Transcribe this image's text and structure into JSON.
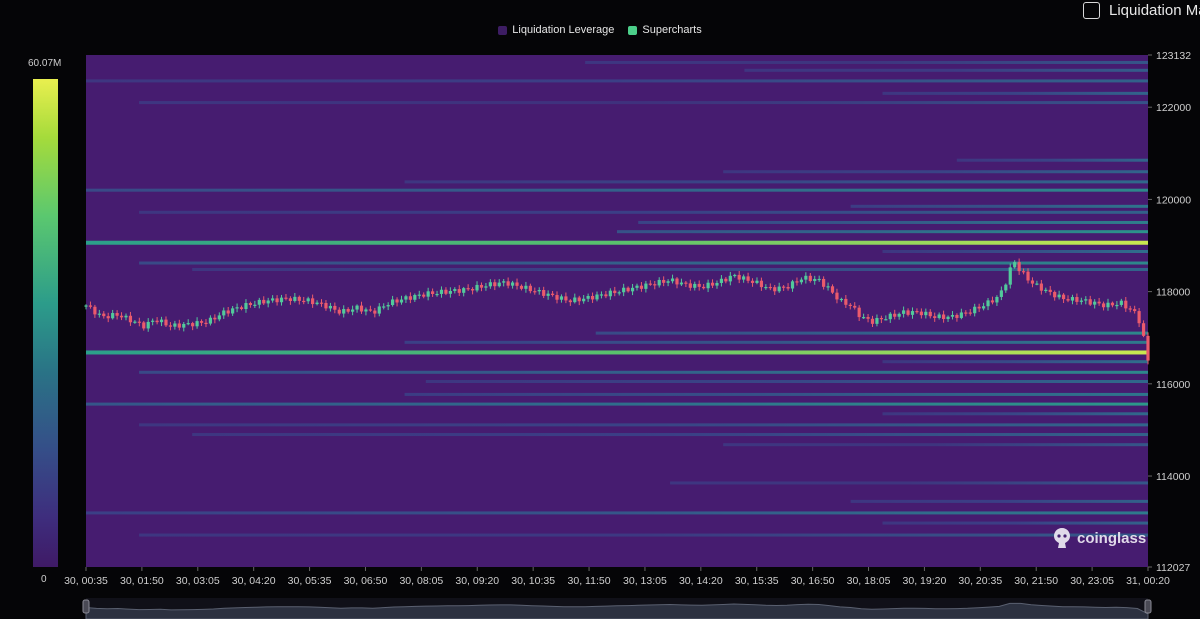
{
  "legend": [
    {
      "label": "Liquidation Leverage",
      "color": "#3d1d63"
    },
    {
      "label": "Supercharts",
      "color": "#4ccf8a"
    }
  ],
  "toggle_label": "Liquidation Ma",
  "color_scale": {
    "max_label": "60.07M",
    "min_label": "0"
  },
  "watermark": "coinglass",
  "chart_data": {
    "type": "heatmap",
    "y_axis": {
      "min": 112027,
      "max": 123132,
      "ticks": [
        "123132",
        "122000",
        "120000",
        "118000",
        "116000",
        "114000",
        "112027"
      ]
    },
    "x_axis": {
      "ticks": [
        "30, 00:35",
        "30, 01:50",
        "30, 03:05",
        "30, 04:20",
        "30, 05:35",
        "30, 06:50",
        "30, 08:05",
        "30, 09:20",
        "30, 10:35",
        "30, 11:50",
        "30, 13:05",
        "30, 14:20",
        "30, 15:35",
        "30, 16:50",
        "30, 18:05",
        "30, 19:20",
        "30, 20:35",
        "30, 21:50",
        "30, 23:05",
        "31, 00:20"
      ]
    },
    "background_color": "#461c70",
    "liquidation_bands": [
      {
        "price": 122970,
        "start": 0.47,
        "intensity": 0.32
      },
      {
        "price": 122800,
        "start": 0.62,
        "intensity": 0.35
      },
      {
        "price": 122570,
        "start": 0.0,
        "intensity": 0.38
      },
      {
        "price": 122300,
        "start": 0.75,
        "intensity": 0.4
      },
      {
        "price": 122100,
        "start": 0.05,
        "intensity": 0.3
      },
      {
        "price": 120850,
        "start": 0.82,
        "intensity": 0.4
      },
      {
        "price": 120600,
        "start": 0.6,
        "intensity": 0.4
      },
      {
        "price": 120380,
        "start": 0.3,
        "intensity": 0.42
      },
      {
        "price": 120200,
        "start": 0.0,
        "intensity": 0.55
      },
      {
        "price": 119850,
        "start": 0.72,
        "intensity": 0.48
      },
      {
        "price": 119720,
        "start": 0.05,
        "intensity": 0.38
      },
      {
        "price": 119500,
        "start": 0.52,
        "intensity": 0.52
      },
      {
        "price": 119300,
        "start": 0.5,
        "intensity": 0.6
      },
      {
        "price": 119060,
        "start": 0.0,
        "intensity": 0.95
      },
      {
        "price": 118870,
        "start": 0.75,
        "intensity": 0.45
      },
      {
        "price": 118620,
        "start": 0.05,
        "intensity": 0.55
      },
      {
        "price": 118480,
        "start": 0.1,
        "intensity": 0.4
      },
      {
        "price": 117100,
        "start": 0.48,
        "intensity": 0.55
      },
      {
        "price": 116900,
        "start": 0.3,
        "intensity": 0.5
      },
      {
        "price": 116680,
        "start": 0.0,
        "intensity": 0.95
      },
      {
        "price": 116480,
        "start": 0.75,
        "intensity": 0.45
      },
      {
        "price": 116250,
        "start": 0.05,
        "intensity": 0.55
      },
      {
        "price": 116050,
        "start": 0.32,
        "intensity": 0.42
      },
      {
        "price": 115770,
        "start": 0.3,
        "intensity": 0.48
      },
      {
        "price": 115560,
        "start": 0.0,
        "intensity": 0.62
      },
      {
        "price": 115350,
        "start": 0.75,
        "intensity": 0.42
      },
      {
        "price": 115110,
        "start": 0.05,
        "intensity": 0.4
      },
      {
        "price": 114900,
        "start": 0.1,
        "intensity": 0.38
      },
      {
        "price": 114680,
        "start": 0.6,
        "intensity": 0.32
      },
      {
        "price": 113850,
        "start": 0.55,
        "intensity": 0.32
      },
      {
        "price": 113450,
        "start": 0.72,
        "intensity": 0.38
      },
      {
        "price": 113200,
        "start": 0.0,
        "intensity": 0.5
      },
      {
        "price": 112980,
        "start": 0.75,
        "intensity": 0.38
      },
      {
        "price": 112720,
        "start": 0.05,
        "intensity": 0.34
      }
    ],
    "price_path": [
      [
        0.0,
        117700
      ],
      [
        0.015,
        117450
      ],
      [
        0.03,
        117500
      ],
      [
        0.045,
        117350
      ],
      [
        0.055,
        117250
      ],
      [
        0.065,
        117400
      ],
      [
        0.08,
        117250
      ],
      [
        0.1,
        117300
      ],
      [
        0.115,
        117350
      ],
      [
        0.13,
        117550
      ],
      [
        0.15,
        117700
      ],
      [
        0.17,
        117800
      ],
      [
        0.19,
        117850
      ],
      [
        0.21,
        117800
      ],
      [
        0.225,
        117700
      ],
      [
        0.24,
        117550
      ],
      [
        0.255,
        117650
      ],
      [
        0.27,
        117550
      ],
      [
        0.285,
        117750
      ],
      [
        0.3,
        117850
      ],
      [
        0.32,
        117950
      ],
      [
        0.34,
        118000
      ],
      [
        0.36,
        118050
      ],
      [
        0.38,
        118150
      ],
      [
        0.395,
        118200
      ],
      [
        0.41,
        118100
      ],
      [
        0.425,
        118000
      ],
      [
        0.44,
        117900
      ],
      [
        0.455,
        117800
      ],
      [
        0.47,
        117850
      ],
      [
        0.49,
        117950
      ],
      [
        0.51,
        118050
      ],
      [
        0.53,
        118150
      ],
      [
        0.55,
        118250
      ],
      [
        0.565,
        118150
      ],
      [
        0.58,
        118100
      ],
      [
        0.595,
        118200
      ],
      [
        0.61,
        118350
      ],
      [
        0.63,
        118200
      ],
      [
        0.645,
        118050
      ],
      [
        0.66,
        118100
      ],
      [
        0.675,
        118300
      ],
      [
        0.69,
        118250
      ],
      [
        0.7,
        118050
      ],
      [
        0.71,
        117800
      ],
      [
        0.72,
        117700
      ],
      [
        0.73,
        117450
      ],
      [
        0.74,
        117350
      ],
      [
        0.755,
        117450
      ],
      [
        0.77,
        117550
      ],
      [
        0.785,
        117550
      ],
      [
        0.8,
        117450
      ],
      [
        0.815,
        117450
      ],
      [
        0.83,
        117550
      ],
      [
        0.845,
        117700
      ],
      [
        0.86,
        117900
      ],
      [
        0.868,
        118300
      ],
      [
        0.873,
        118700
      ],
      [
        0.878,
        118500
      ],
      [
        0.89,
        118200
      ],
      [
        0.905,
        118000
      ],
      [
        0.92,
        117850
      ],
      [
        0.94,
        117800
      ],
      [
        0.96,
        117700
      ],
      [
        0.975,
        117750
      ],
      [
        0.99,
        117500
      ],
      [
        0.995,
        117100
      ],
      [
        1.0,
        116500
      ]
    ]
  }
}
